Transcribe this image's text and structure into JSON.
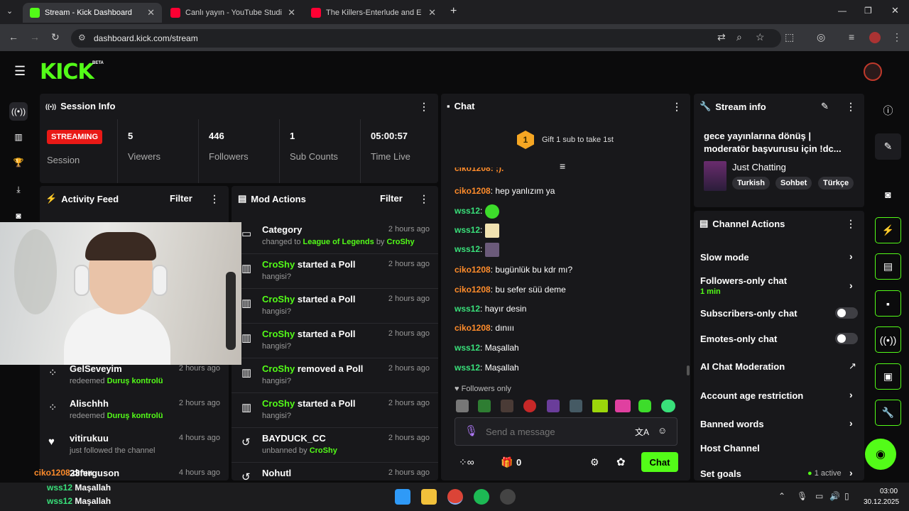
{
  "browser": {
    "tabs": [
      {
        "label": "Stream - Kick Dashboard"
      },
      {
        "label": "Canlı yayın - YouTube Studio"
      },
      {
        "label": "The Killers-Enterlude and E"
      }
    ],
    "url": "dashboard.kick.com/stream"
  },
  "brand": {
    "logo": "KICK",
    "badge": "BETA",
    "accent": "#53fc18"
  },
  "session": {
    "title": "Session Info",
    "status": "STREAMING",
    "session_label": "Session",
    "stats": [
      {
        "value": "5",
        "label": "Viewers"
      },
      {
        "value": "446",
        "label": "Followers"
      },
      {
        "value": "1",
        "label": "Sub Counts"
      },
      {
        "value": "05:00:57",
        "label": "Time Live"
      }
    ]
  },
  "activity": {
    "title": "Activity Feed",
    "filter": "Filter",
    "items": [
      {
        "user": "GelSeveyim",
        "text_prefix": "redeemed",
        "highlight": "Duruş kontrolü",
        "time": "2 hours ago"
      },
      {
        "user": "Alischhh",
        "text_prefix": "redeemed",
        "highlight": "Duruş kontrolü",
        "time": "2 hours ago"
      },
      {
        "user": "vitirukuu",
        "text_prefix": "just followed the channel",
        "highlight": "",
        "time": "4 hours ago"
      },
      {
        "user": "23ferguson",
        "text_prefix": "",
        "highlight": "",
        "time": "4 hours ago"
      }
    ]
  },
  "mod": {
    "title": "Mod Actions",
    "filter": "Filter",
    "items": [
      {
        "actor": "",
        "action": "Category",
        "sub_prefix": "changed to",
        "sub_hl": "League of Legends",
        "sub_by": "by",
        "sub_by_user": "CroShy",
        "time": "2 hours ago"
      },
      {
        "actor": "CroShy",
        "action": "started a Poll",
        "sub_prefix": "hangisi?",
        "sub_hl": "",
        "sub_by": "",
        "sub_by_user": "",
        "time": "2 hours ago"
      },
      {
        "actor": "CroShy",
        "action": "started a Poll",
        "sub_prefix": "hangisi?",
        "sub_hl": "",
        "sub_by": "",
        "sub_by_user": "",
        "time": "2 hours ago"
      },
      {
        "actor": "CroShy",
        "action": "started a Poll",
        "sub_prefix": "hangisi?",
        "sub_hl": "",
        "sub_by": "",
        "sub_by_user": "",
        "time": "2 hours ago"
      },
      {
        "actor": "CroShy",
        "action": "removed a Poll",
        "sub_prefix": "hangisi?",
        "sub_hl": "",
        "sub_by": "",
        "sub_by_user": "",
        "time": "2 hours ago"
      },
      {
        "actor": "CroShy",
        "action": "started a Poll",
        "sub_prefix": "hangisi?",
        "sub_hl": "",
        "sub_by": "",
        "sub_by_user": "",
        "time": "2 hours ago"
      },
      {
        "actor": "",
        "action": "BAYDUCK_CC",
        "sub_prefix": "unbanned by",
        "sub_hl": "",
        "sub_by": "",
        "sub_by_user": "CroShy",
        "time": "2 hours ago"
      },
      {
        "actor": "",
        "action": "Nohutl",
        "sub_prefix": "",
        "sub_hl": "",
        "sub_by": "",
        "sub_by_user": "",
        "time": "2 hours ago"
      }
    ]
  },
  "chat": {
    "title": "Chat",
    "gift_count": "1",
    "gift_text": "Gift 1 sub to take 1st",
    "partial_top": "ciko1208: ;).",
    "messages": [
      {
        "user": "ciko1208",
        "text": "hep yanlızım ya",
        "color": "org"
      },
      {
        "user": "wss12",
        "text": "",
        "color": "grn"
      },
      {
        "user": "wss12",
        "text": "",
        "color": "grn"
      },
      {
        "user": "wss12",
        "text": "",
        "color": "grn"
      },
      {
        "user": "ciko1208",
        "text": "bugünlük bu kdr mı?",
        "color": "org"
      },
      {
        "user": "ciko1208",
        "text": "bu sefer süü deme",
        "color": "org"
      },
      {
        "user": "wss12",
        "text": "hayır desin",
        "color": "grn"
      },
      {
        "user": "ciko1208",
        "text": "dınııı",
        "color": "org"
      },
      {
        "user": "wss12",
        "text": "Maşallah",
        "color": "grn"
      },
      {
        "user": "wss12",
        "text": "Maşallah",
        "color": "grn"
      }
    ],
    "followers_only": "Followers only",
    "placeholder": "Send a message",
    "points": "0",
    "send": "Chat"
  },
  "stream_info": {
    "title": "Stream info",
    "stream_title": "gece yayınlarına dönüş | moderatör başvurusu için !dc...",
    "category": "Just Chatting",
    "tags": [
      "Turkish",
      "Sohbet",
      "Türkçe"
    ]
  },
  "channel_actions": {
    "title": "Channel Actions",
    "slow_mode": "Slow mode",
    "followers_only": "Followers-only chat",
    "followers_only_value": "1 min",
    "subs_only": "Subscribers-only chat",
    "emotes_only": "Emotes-only chat",
    "ai_mod": "AI Chat Moderation",
    "age": "Account age restriction",
    "banned": "Banned words",
    "host": "Host Channel",
    "goals": "Set goals",
    "goals_status": "1 active"
  },
  "overlay": {
    "line1_user": "ciko1208",
    "line1_text": "dınııı",
    "line2_user": "wss12",
    "line2_text": "Maşallah",
    "line3_user": "wss12",
    "line3_text": "Maşallah"
  },
  "taskbar": {
    "time": "03:00",
    "date": "30.12.2025"
  }
}
